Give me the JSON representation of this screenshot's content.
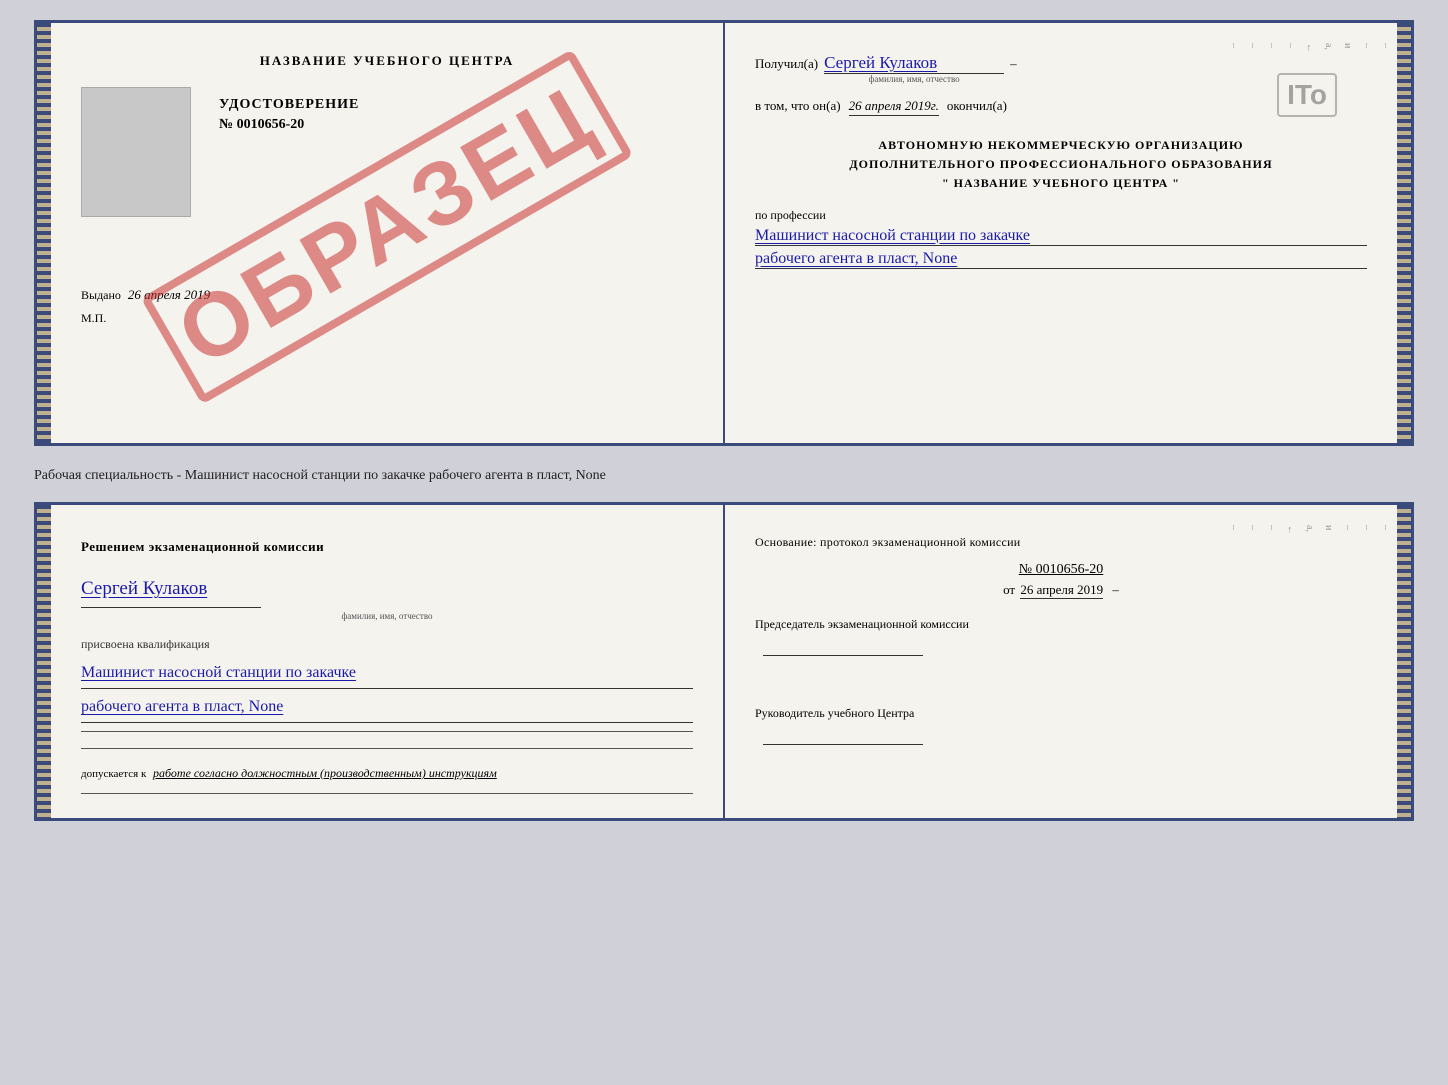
{
  "topSpread": {
    "left": {
      "centerTitle": "НАЗВАНИЕ УЧЕБНОГО ЦЕНТРА",
      "watermark": "ОБРАЗЕЦ",
      "certLabel": "УДОСТОВЕРЕНИЕ",
      "certNumber": "№ 0010656-20",
      "issuedPrefix": "Выдано",
      "issuedDate": "26 апреля 2019",
      "mpLabel": "М.П."
    },
    "right": {
      "receivedPrefix": "Получил(а)",
      "receivedName": "Сергей Кулаков",
      "nameCaption": "фамилия, имя, отчество",
      "inThatPrefix": "в том, что он(а)",
      "inThatDate": "26 апреля 2019г.",
      "completedLabel": "окончил(а)",
      "orgLine1": "АВТОНОМНУЮ НЕКОММЕРЧЕСКУЮ ОРГАНИЗАЦИЮ",
      "orgLine2": "ДОПОЛНИТЕЛЬНОГО ПРОФЕССИОНАЛЬНОГО ОБРАЗОВАНИЯ",
      "orgLine3": "\"  НАЗВАНИЕ УЧЕБНОГО ЦЕНТРА  \"",
      "professionLabel": "по профессии",
      "professionLine1": "Машинист насосной станции по закачке",
      "professionLine2": "рабочего агента в пласт, None"
    }
  },
  "betweenText": "Рабочая специальность - Машинист насосной станции по закачке рабочего агента в пласт, None",
  "bottomSpread": {
    "left": {
      "commissionTitle": "Решением экзаменационной комиссии",
      "personName": "Сергей Кулаков",
      "nameCaption": "фамилия, имя, отчество",
      "assignedLabel": "присвоена квалификация",
      "qualLine1": "Машинист насосной станции по закачке",
      "qualLine2": "рабочего агента в пласт, None",
      "allowsPrefix": "допускается к",
      "allowsText": "работе согласно должностным (производственным) инструкциям"
    },
    "right": {
      "basisLabel": "Основание: протокол экзаменационной комиссии",
      "protocolNumber": "№ 0010656-20",
      "protocolDatePrefix": "от",
      "protocolDate": "26 апреля 2019",
      "chairmanLabel": "Председатель экзаменационной комиссии",
      "directorLabel": "Руководитель учебного Центра"
    }
  },
  "itoStamp": "ITo"
}
